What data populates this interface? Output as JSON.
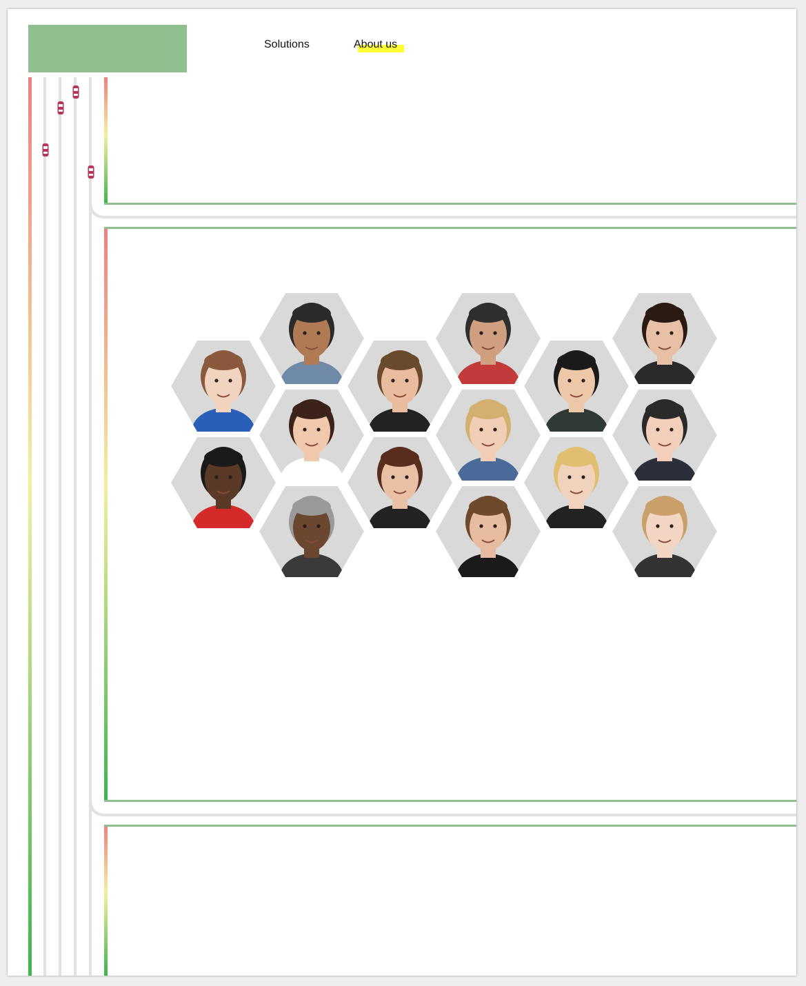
{
  "header": {
    "logo_color": "#8fbf8f",
    "nav": [
      {
        "label": "Solutions"
      },
      {
        "label": "About us",
        "highlight_color": "#ffff33"
      }
    ]
  },
  "decoration": {
    "lane_gradient_top": "#ef7f7f",
    "lane_gradient_mid": "#f4ef9f",
    "lane_gradient_bottom": "#3cb54a",
    "section_border_color": "#8fbf8f",
    "car_icon_color": "#b8355a"
  },
  "team_gallery": {
    "tile_background": "#d9d9d9",
    "members": [
      {
        "skin": "#f2d3c0",
        "hair": "#8b5a3c",
        "shirt": "#2a5fb8"
      },
      {
        "skin": "#5a3a26",
        "hair": "#1a1a1a",
        "shirt": "#d42a2a"
      },
      {
        "skin": "#b07a55",
        "hair": "#2b2b2b",
        "shirt": "#6e8aa8"
      },
      {
        "skin": "#f0c9ad",
        "hair": "#3b231a",
        "shirt": "#ffffff"
      },
      {
        "skin": "#6b4730",
        "hair": "#9a9a9a",
        "shirt": "#3a3a3a"
      },
      {
        "skin": "#e9bc9e",
        "hair": "#6a4a2c",
        "shirt": "#222222"
      },
      {
        "skin": "#e8c0a4",
        "hair": "#5a2e1e",
        "shirt": "#222222"
      },
      {
        "skin": "#cf9f80",
        "hair": "#2e2e2e",
        "shirt": "#c23a3a"
      },
      {
        "skin": "#f0cdb5",
        "hair": "#d4b070",
        "shirt": "#4a6a9a"
      },
      {
        "skin": "#e8bca0",
        "hair": "#6e4a2a",
        "shirt": "#1a1a1a"
      },
      {
        "skin": "#ecc8a8",
        "hair": "#1a1a1a",
        "shirt": "#2f3a35"
      },
      {
        "skin": "#f0d2bd",
        "hair": "#e0c070",
        "shirt": "#222222"
      },
      {
        "skin": "#e8c0a6",
        "hair": "#2a1a12",
        "shirt": "#2a2a2a"
      },
      {
        "skin": "#f1cfba",
        "hair": "#2a2a2a",
        "shirt": "#2a2f3a"
      },
      {
        "skin": "#f2d5c2",
        "hair": "#c9a06a",
        "shirt": "#333333"
      }
    ]
  }
}
